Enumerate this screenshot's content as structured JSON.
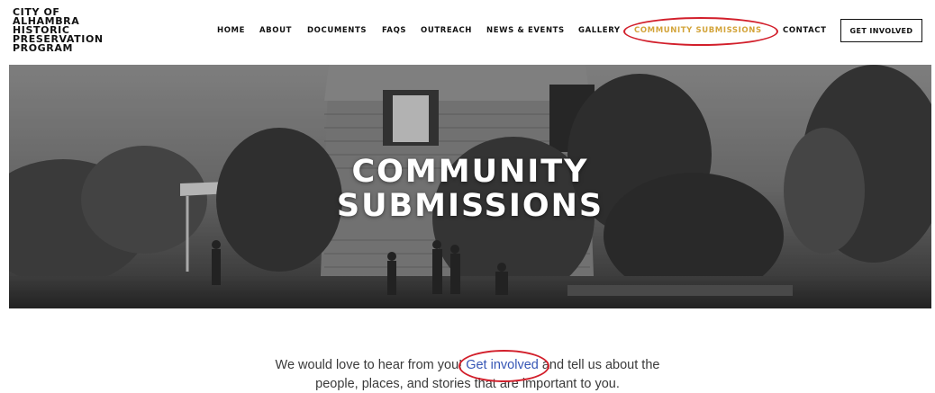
{
  "logo": {
    "lines": [
      "CITY OF",
      "ALHAMBRA",
      "HISTORIC",
      "PRESERVATION",
      "PROGRAM"
    ]
  },
  "nav": {
    "items": [
      {
        "label": "HOME"
      },
      {
        "label": "ABOUT"
      },
      {
        "label": "DOCUMENTS"
      },
      {
        "label": "FAQS"
      },
      {
        "label": "OUTREACH"
      },
      {
        "label": "NEWS & EVENTS"
      },
      {
        "label": "GALLERY"
      },
      {
        "label": "COMMUNITY SUBMISSIONS",
        "active": true
      },
      {
        "label": "CONTACT"
      }
    ],
    "cta_label": "GET INVOLVED"
  },
  "hero": {
    "title_line1": "COMMUNITY",
    "title_line2": "SUBMISSIONS"
  },
  "intro": {
    "before_link": "We would love to hear from you! ",
    "link_text": "Get involved",
    "after_link": " and tell us about the",
    "line2": "people, places, and stories that are important to you."
  },
  "colors": {
    "active_nav": "#d3a43a",
    "link": "#3656b5",
    "annotation": "#d21f2b"
  }
}
